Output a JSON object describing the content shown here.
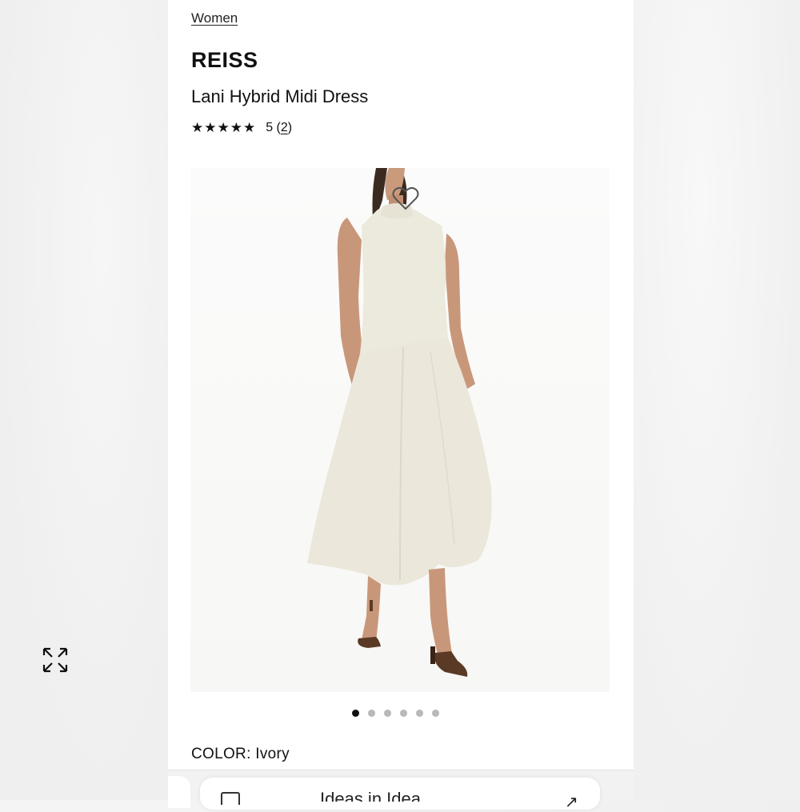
{
  "breadcrumb": {
    "label": "Women"
  },
  "product": {
    "brand": "REISS",
    "name": "Lani Hybrid Midi Dress",
    "stars": "★★★★★",
    "rating_text": "5 (",
    "review_count": "2",
    "rating_close": ")",
    "rating_value": 5
  },
  "gallery": {
    "image_alt": "Model wearing ivory sleeveless midi dress",
    "total_images": 6,
    "active_index": 0,
    "icons": {
      "favorite": "heart-icon",
      "expand": "expand-icon"
    }
  },
  "color": {
    "label": "COLOR: ",
    "value": "Ivory"
  },
  "browser": {
    "url": "Ideas  in  Idea"
  },
  "colors": {
    "text": "#111111",
    "dress": "#ece9dd",
    "dot_active": "#111111",
    "dot_inactive": "#b8b8b8"
  }
}
